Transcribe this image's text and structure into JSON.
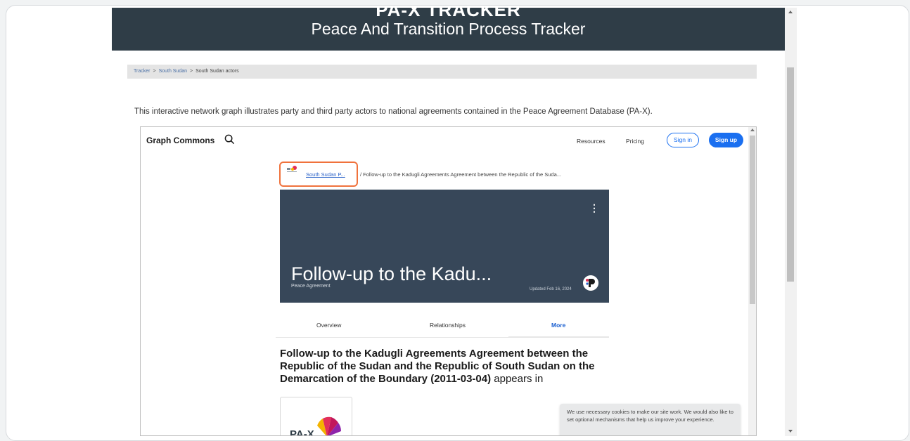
{
  "header": {
    "brand": "PA-X TRACKER",
    "subtitle": "Peace And Transition Process Tracker"
  },
  "breadcrumb": {
    "items": [
      "Tracker",
      "South Sudan",
      "South Sudan actors"
    ],
    "separator": ">"
  },
  "intro_text": "This interactive network graph illustrates party and third party actors to national agreements contained in the Peace Agreement Database (PA-X).",
  "embed": {
    "logo": "Graph Commons",
    "nav": {
      "resources": "Resources",
      "pricing": "Pricing",
      "sign_in": "Sign in",
      "sign_up": "Sign up"
    },
    "crumb": {
      "parent_link": "South Sudan P...",
      "rest": "/ Follow-up to the Kadugli Agreements Agreement between the Republic of the Suda..."
    },
    "card": {
      "title": "Follow-up to the Kadu...",
      "type": "Peace Agreement",
      "updated": "Updated Feb 16, 2024",
      "menu_glyph": "⋮"
    },
    "tabs": [
      "Overview",
      "Relationships",
      "More"
    ],
    "active_tab": "More",
    "appears": {
      "bold": "Follow-up to the Kadugli Agreements Agreement between the Republic of the Sudan and the Republic of South Sudan on the Demarcation of the Boundary (2011-03-04)",
      "rest": " appears in"
    },
    "pax_card_label": "PA-X",
    "cookie_text": "We use necessary cookies to make our site work. We would also like to set optional mechanisms that help us improve your experience."
  },
  "colors": {
    "header_bg": "#2f3d47",
    "card_bg": "#374759",
    "accent": "#1a6ff0",
    "highlight": "#f0723c"
  }
}
